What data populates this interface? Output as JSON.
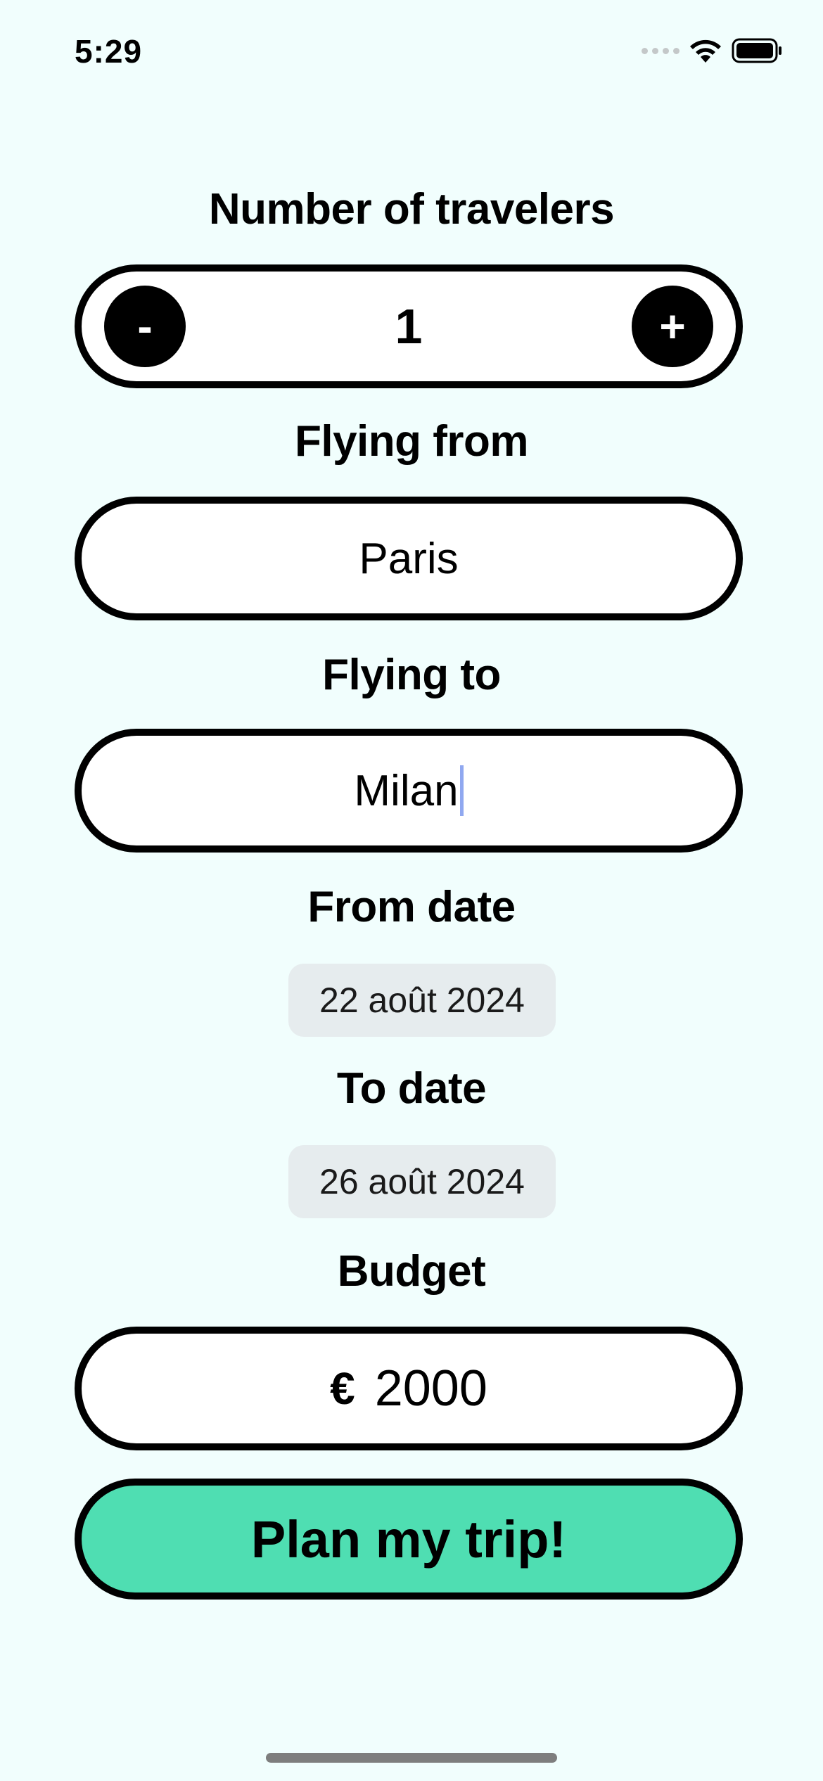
{
  "status_bar": {
    "time": "5:29",
    "icons": [
      "signal-dots-icon",
      "wifi-icon",
      "battery-icon"
    ]
  },
  "travelers": {
    "label": "Number of travelers",
    "decrement_label": "-",
    "count": "1",
    "increment_label": "+"
  },
  "flying_from": {
    "label": "Flying from",
    "value": "Paris"
  },
  "flying_to": {
    "label": "Flying to",
    "value": "Milan"
  },
  "from_date": {
    "label": "From date",
    "value": "22 août 2024"
  },
  "to_date": {
    "label": "To date",
    "value": "26 août 2024"
  },
  "budget": {
    "label": "Budget",
    "currency_symbol": "€",
    "value": "2000"
  },
  "cta": {
    "label": "Plan my trip!"
  },
  "colors": {
    "background": "#f1fefd",
    "field_background": "#ffffff",
    "border": "#000000",
    "cta_background": "#4fdeb2",
    "date_chip_background": "#e6ecee",
    "caret": "#90a8f0"
  }
}
